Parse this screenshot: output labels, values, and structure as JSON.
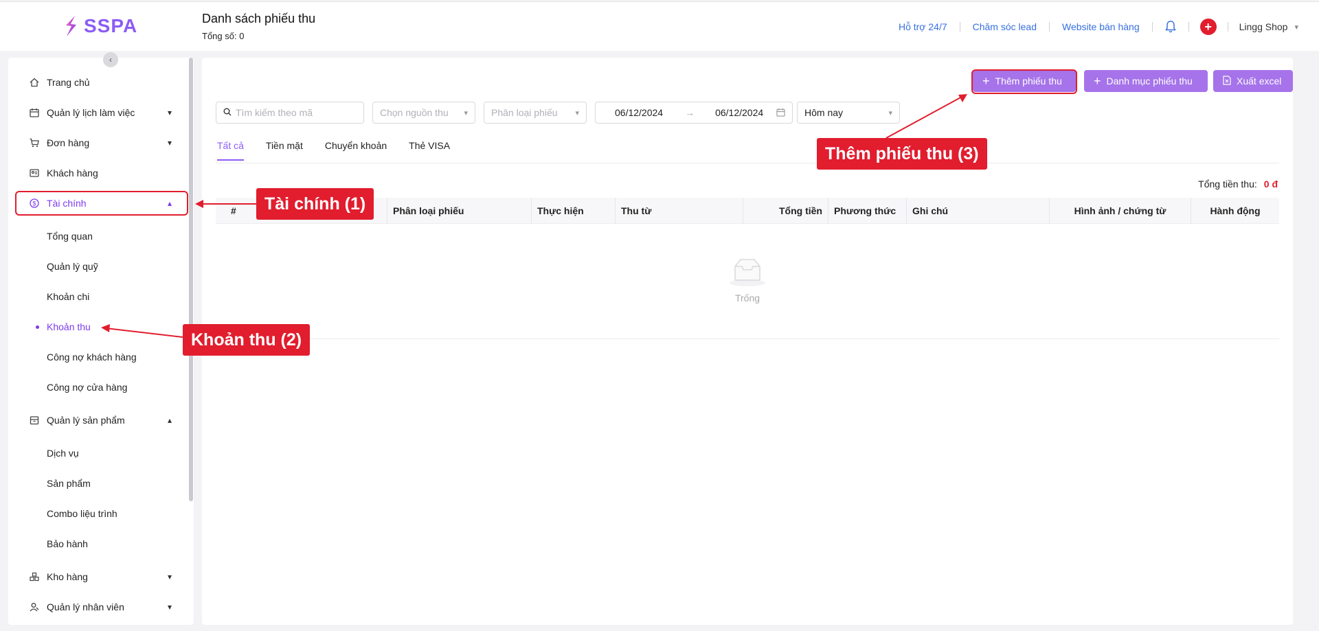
{
  "header": {
    "logo_text": "SSPA",
    "title": "Danh sách phiếu thu",
    "subtitle": "Tổng số: 0",
    "links": [
      "Hỗ trợ 24/7",
      "Chăm sóc lead",
      "Website bán hàng"
    ],
    "shop_name": "Lingg Shop",
    "plus_label": "+"
  },
  "sidebar": {
    "items": [
      {
        "label": "Trang chủ",
        "icon": "home-icon"
      },
      {
        "label": "Quản lý lịch làm việc",
        "icon": "calendar-icon"
      },
      {
        "label": "Đơn hàng",
        "icon": "cart-icon"
      },
      {
        "label": "Khách hàng",
        "icon": "customer-card-icon"
      },
      {
        "label": "Tài chính",
        "icon": "dollar-circle-icon"
      },
      {
        "label": "Quản lý sản phẩm",
        "icon": "box-icon"
      },
      {
        "label": "Kho hàng",
        "icon": "warehouse-icon"
      },
      {
        "label": "Quản lý nhân viên",
        "icon": "staff-icon"
      }
    ],
    "finance_sub": [
      "Tổng quan",
      "Quản lý quỹ",
      "Khoản chi",
      "Khoản thu",
      "Công nợ khách hàng",
      "Công nợ cửa hàng"
    ],
    "product_sub": [
      "Dịch vụ",
      "Sản phẩm",
      "Combo liệu trình",
      "Bảo hành"
    ]
  },
  "toolbar": {
    "add_receipt": "Thêm phiếu thu",
    "receipt_category": "Danh mục phiếu thu",
    "export_excel": "Xuất excel"
  },
  "filters": {
    "search_placeholder": "Tìm kiếm theo mã",
    "source_placeholder": "Chọn nguồn thu",
    "type_placeholder": "Phân loại phiếu",
    "date_from": "06/12/2024",
    "date_to": "06/12/2024",
    "date_arrow": "→",
    "period": "Hôm nay"
  },
  "tabs": [
    "Tất cả",
    "Tiền mặt",
    "Chuyển khoản",
    "Thẻ VISA"
  ],
  "summary": {
    "label": "Tổng tiền thu:",
    "value": "0 đ"
  },
  "table": {
    "columns": [
      "#",
      "Phân loại phiếu",
      "Thực hiện",
      "Thu từ",
      "Tổng tiền",
      "Phương thức",
      "Ghi chú",
      "Hình ảnh / chứng từ",
      "Hành động"
    ],
    "empty_text": "Trống"
  },
  "callouts": {
    "finance": "Tài chính (1)",
    "receipts": "Khoản thu (2)",
    "add_receipt": "Thêm phiếu thu (3)"
  },
  "colors": {
    "accent": "#8b5cf6",
    "button": "#a673ea",
    "highlight": "#e11d2e",
    "link": "#3570e0"
  }
}
